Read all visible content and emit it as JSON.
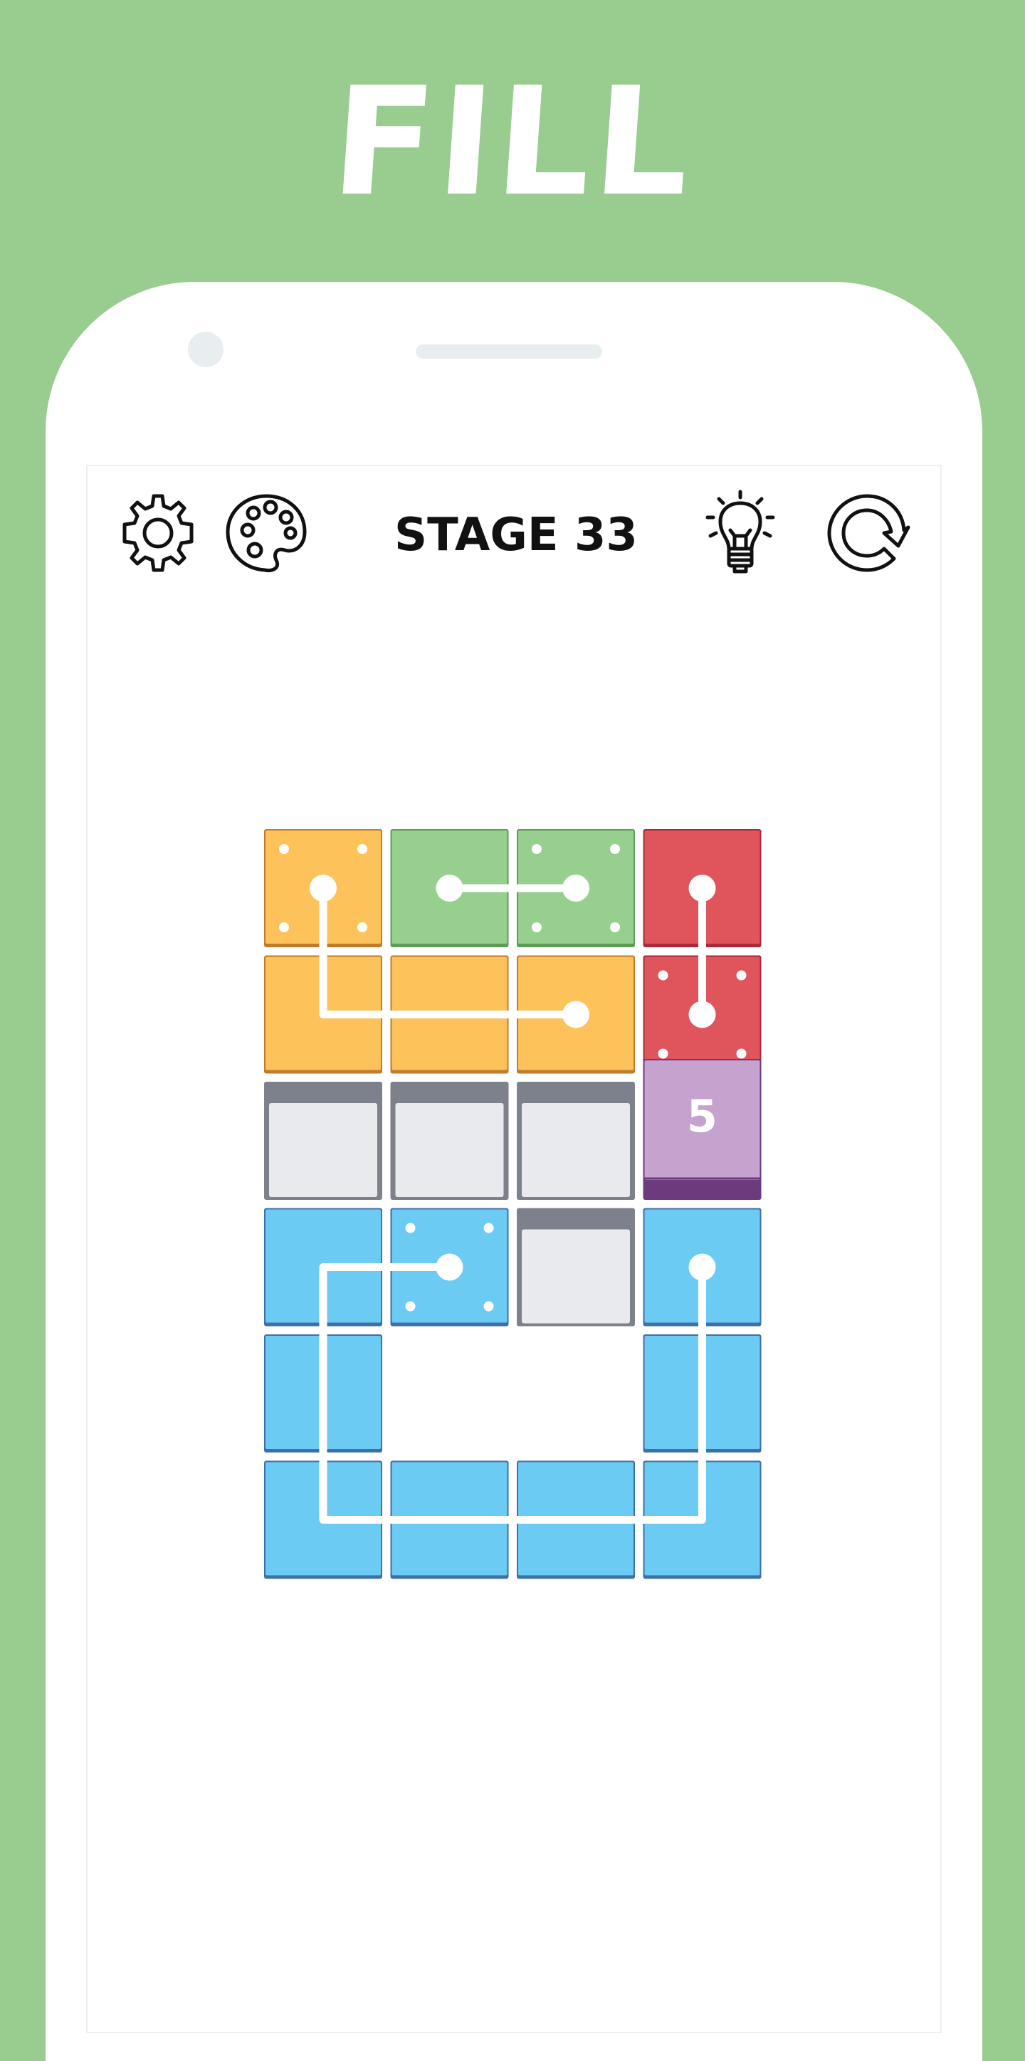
{
  "title": "FILL",
  "header": {
    "stage_label": "STAGE 33",
    "icons": [
      "gear-icon",
      "palette-icon",
      "lightbulb-icon",
      "restart-icon"
    ]
  },
  "colors": {
    "background": "#98cd8f",
    "orange": "#fdc25a",
    "green": "#96cf8e",
    "red": "#e0545c",
    "purple": "#c6a2cf",
    "blue": "#6bcbf3",
    "gray": "#e9eaee"
  },
  "board": {
    "rows": 6,
    "cols": 4,
    "cells": [
      [
        "orange-anchor",
        "green",
        "green-anchor",
        "red"
      ],
      [
        "orange",
        "orange",
        "orange",
        "red-anchor"
      ],
      [
        "gray",
        "gray",
        "gray",
        "purple-counter"
      ],
      [
        "blue",
        "blue-anchor",
        "gray",
        "blue"
      ],
      [
        "blue",
        "empty",
        "empty",
        "blue"
      ],
      [
        "blue",
        "blue",
        "blue",
        "blue"
      ]
    ],
    "counter_value": "5",
    "paths": [
      {
        "color": "orange",
        "cells": [
          [
            0,
            0
          ],
          [
            1,
            0
          ],
          [
            1,
            1
          ],
          [
            1,
            2
          ]
        ]
      },
      {
        "color": "green",
        "cells": [
          [
            0,
            1
          ],
          [
            0,
            2
          ]
        ]
      },
      {
        "color": "red",
        "cells": [
          [
            0,
            3
          ],
          [
            1,
            3
          ]
        ]
      },
      {
        "color": "blue",
        "cells": [
          [
            3,
            1
          ],
          [
            3,
            0
          ],
          [
            4,
            0
          ],
          [
            5,
            0
          ],
          [
            5,
            1
          ],
          [
            5,
            2
          ],
          [
            5,
            3
          ],
          [
            4,
            3
          ],
          [
            3,
            3
          ]
        ]
      }
    ]
  }
}
